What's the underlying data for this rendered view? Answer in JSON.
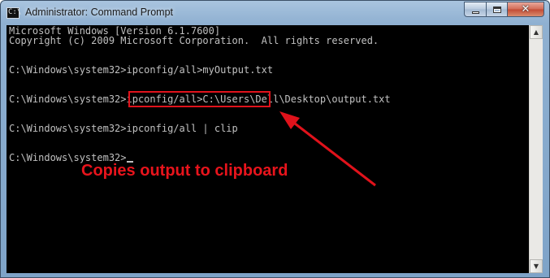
{
  "window": {
    "title": "Administrator: Command Prompt",
    "icon_label": "C:\\"
  },
  "caption_buttons": {
    "minimize_icon": "minimize-icon",
    "maximize_icon": "maximize-icon",
    "close_icon": "close-icon",
    "close_glyph": "✕"
  },
  "console": {
    "lines": [
      "Microsoft Windows [Version 6.1.7600]",
      "Copyright (c) 2009 Microsoft Corporation.  All rights reserved.",
      "",
      "C:\\Windows\\system32>ipconfig/all>myOutput.txt",
      "",
      "C:\\Windows\\system32>ipconfig/all>C:\\Users\\Dell\\Desktop\\output.txt",
      "",
      "C:\\Windows\\system32>ipconfig/all | clip",
      "",
      "C:\\Windows\\system32>"
    ]
  },
  "annotation": {
    "text": "Copies output to clipboard",
    "color": "#e8141c"
  },
  "scrollbar": {
    "up_glyph": "▲",
    "down_glyph": "▼"
  },
  "colors": {
    "console_bg": "#000000",
    "console_text": "#c0c0c0",
    "highlight": "#e0121b"
  }
}
